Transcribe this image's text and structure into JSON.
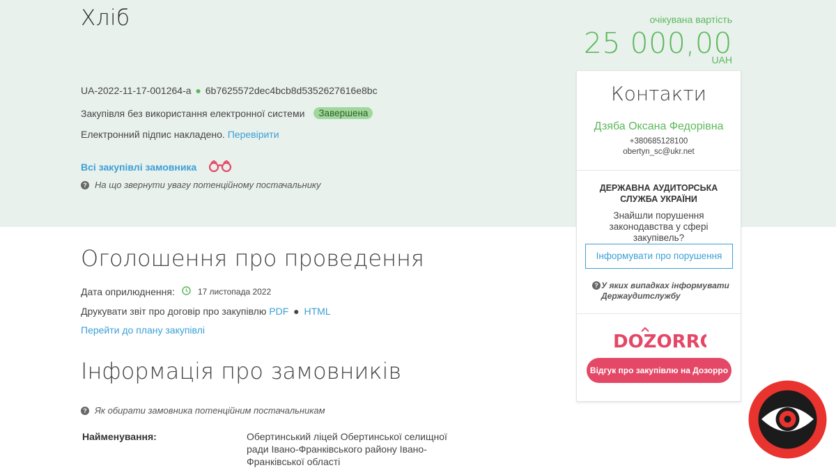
{
  "tender": {
    "title": "Хліб",
    "expected_label": "очікувана вартість",
    "price": "25 000,00",
    "currency": "UAH",
    "id": "UA-2022-11-17-001264-a",
    "hash": "6b7625572dec4bcb8d5352627616e8bc",
    "procurement_mode": "Закупівля без використання електронної системи",
    "status": "Завершена",
    "signature_text": "Електронний підпис накладено.",
    "signature_link": "Перевірити",
    "all_procurements_link": "Всі закупівлі замовника",
    "hint": "На що звернути увагу потенційному постачальнику"
  },
  "announcement": {
    "heading": "Оголошення про проведення",
    "date_label": "Дата оприлюднення:",
    "date_value": "17 листопада 2022",
    "print_label": "Друкувати звіт про договір про закупівлю",
    "print_pdf": "PDF",
    "print_html": "HTML",
    "plan_link": "Перейти до плану закупівлі"
  },
  "customers": {
    "heading": "Інформація про замовників",
    "hint": "Як обирати замовника потенційним постачальникам",
    "name_label": "Найменування:",
    "name_value": "Обертинський ліцей Обертинської селищної ради Івано-Франківського району Івано-Франківської області"
  },
  "contacts": {
    "title": "Контакти",
    "person": "Дзяба Оксана Федорівна",
    "phone": "+380685128100",
    "email": "obertyn_sc@ukr.net"
  },
  "audit": {
    "org": "ДЕРЖАВНА АУДИТОРСЬКА СЛУЖБА УКРАЇНИ",
    "found": "Знайшли порушення законодавства у сфері закупівель?",
    "inform_button": "Інформувати про порушення",
    "which_cases": "У яких випадках інформувати Держаудитслужбу"
  },
  "dozorro": {
    "logo": "DOZORRO",
    "feedback_button": "Відгук про закупівлю на Дозорро"
  },
  "colors": {
    "green": "#5cb85c",
    "link": "#3a9fd6",
    "hero_bg": "#e9f1ed",
    "dozorro_red": "#e44866"
  }
}
